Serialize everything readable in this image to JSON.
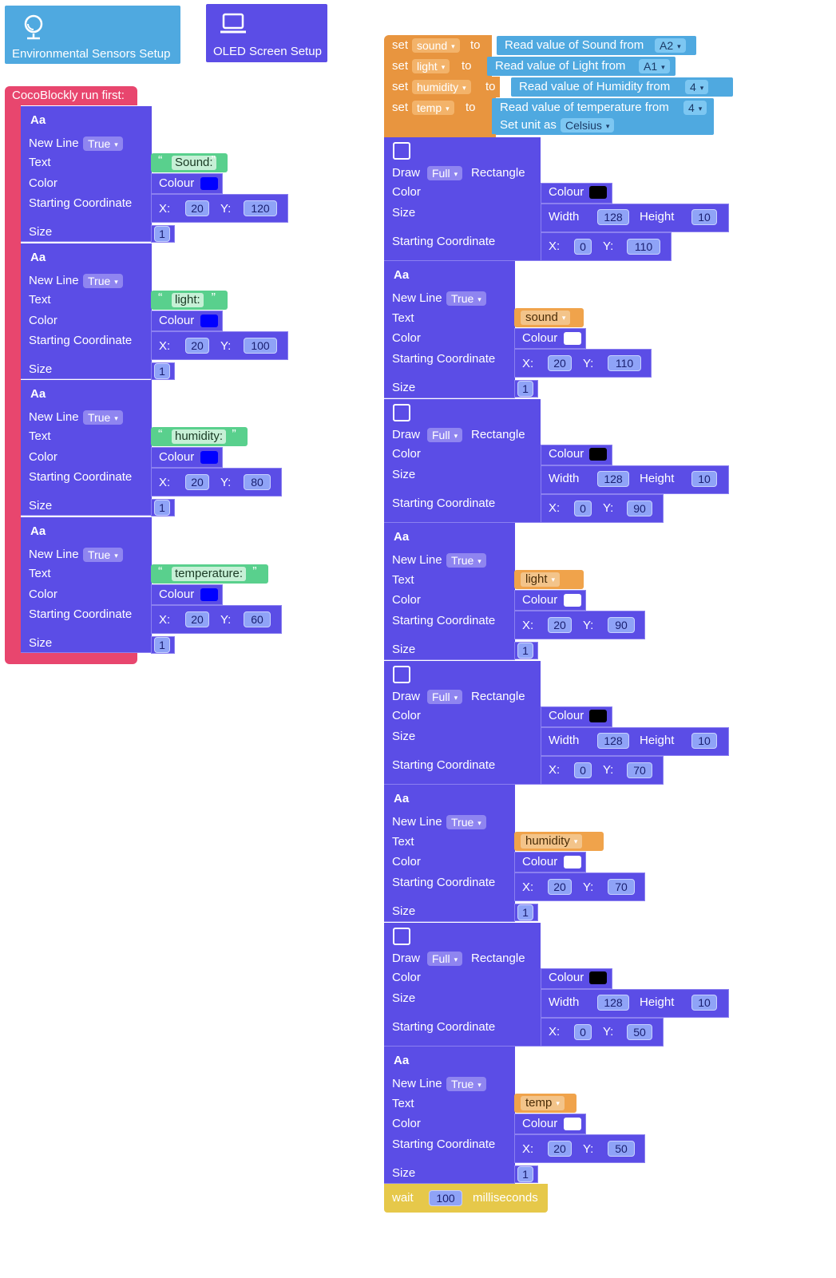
{
  "toolbox": {
    "env_label": "Environmental Sensors Setup",
    "oled_label": "OLED Screen Setup"
  },
  "colors": {
    "block_purple": "#5b4de6",
    "run_first_pink": "#e8466e",
    "sensor_blue": "#4fa9e0",
    "var_orange": "#e8953f",
    "wait_yellow": "#e6c84a",
    "string_green": "#59d08d",
    "color_blue": "#0000ff",
    "color_black": "#000000",
    "color_white": "#ffffff"
  },
  "labels": {
    "run_first": "CocoBlockly run first:",
    "aa": "Aa",
    "new_line": "New Line",
    "true": "True",
    "text": "Text",
    "color": "Color",
    "colour": "Colour",
    "start": "Starting Coordinate",
    "size": "Size",
    "x": "X:",
    "y": "Y:",
    "draw": "Draw",
    "full": "Full",
    "rectangle": "Rectangle",
    "width": "Width",
    "height": "Height",
    "set": "set",
    "to": "to",
    "set_unit": "Set unit as",
    "celsius": "Celsius",
    "wait": "wait",
    "milliseconds": "milliseconds"
  },
  "left_texts": [
    {
      "text": "Sound:",
      "x": "20",
      "y": "120",
      "size": "1"
    },
    {
      "text": "light:",
      "x": "20",
      "y": "100",
      "size": "1"
    },
    {
      "text": "humidity:",
      "x": "20",
      "y": "80",
      "size": "1"
    },
    {
      "text": "temperature:",
      "x": "20",
      "y": "60",
      "size": "1"
    }
  ],
  "sets": [
    {
      "var": "sound",
      "read": "Read value of Sound from",
      "pin": "A2"
    },
    {
      "var": "light",
      "read": "Read value of Light from",
      "pin": "A1"
    },
    {
      "var": "humidity",
      "read": "Read value of Humidity from",
      "pin": "4"
    },
    {
      "var": "temp",
      "read": "Read value of temperature from",
      "pin": "4"
    }
  ],
  "rects": [
    {
      "width": "128",
      "height": "10",
      "x": "0",
      "y": "110"
    },
    {
      "width": "128",
      "height": "10",
      "x": "0",
      "y": "90"
    },
    {
      "width": "128",
      "height": "10",
      "x": "0",
      "y": "70"
    },
    {
      "width": "128",
      "height": "10",
      "x": "0",
      "y": "50"
    }
  ],
  "right_texts": [
    {
      "var": "sound",
      "x": "20",
      "y": "110",
      "size": "1"
    },
    {
      "var": "light",
      "x": "20",
      "y": "90",
      "size": "1"
    },
    {
      "var": "humidity",
      "x": "20",
      "y": "70",
      "size": "1"
    },
    {
      "var": "temp",
      "x": "20",
      "y": "50",
      "size": "1"
    }
  ],
  "wait_ms": "100"
}
